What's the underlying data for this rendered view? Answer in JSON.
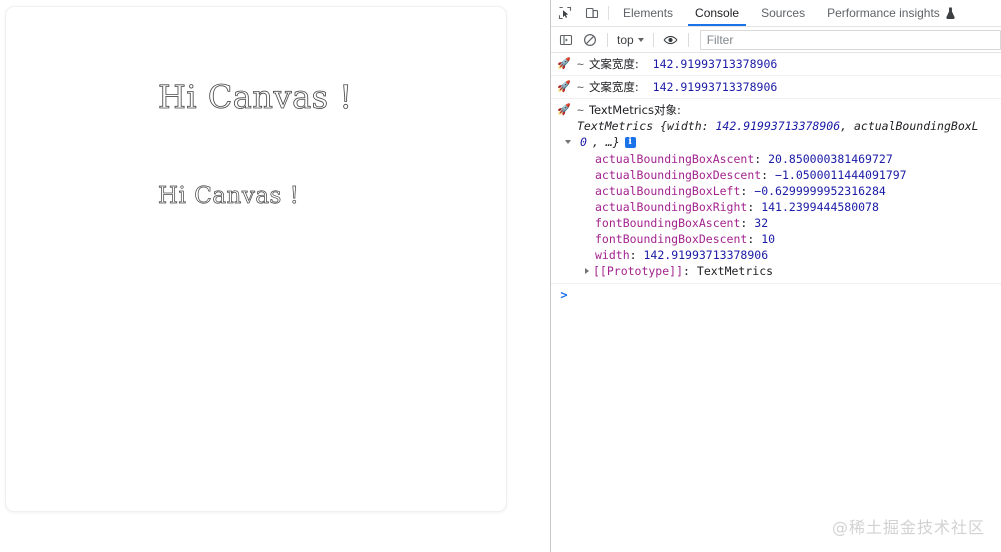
{
  "canvas": {
    "texts": [
      {
        "content": "Hi Canvas !",
        "style": "stroked-large"
      },
      {
        "content": "Hi Canvas !",
        "style": "stroked-small"
      }
    ]
  },
  "devtools": {
    "tabs": [
      {
        "label": "Elements",
        "active": false
      },
      {
        "label": "Console",
        "active": true
      },
      {
        "label": "Sources",
        "active": false
      },
      {
        "label": "Performance insights",
        "active": false,
        "icon": "flask-icon"
      }
    ],
    "icons": {
      "inspect": "inspect-element-icon",
      "device": "device-toolbar-icon",
      "sidebar": "console-sidebar-icon",
      "clear": "clear-console-icon",
      "eye": "live-expression-icon",
      "flask": "experiment-flask-icon"
    },
    "toolbar": {
      "context_label": "top",
      "filter_placeholder": "Filter",
      "filter_value": ""
    },
    "accent_color": "#1a73e8",
    "console": {
      "rows": [
        {
          "type": "log",
          "icon": "rocket",
          "tilde": "~",
          "label": "文案宽度:",
          "value": "142.91993713378906"
        },
        {
          "type": "log",
          "icon": "rocket",
          "tilde": "~",
          "label": "文案宽度:",
          "value": "142.91993713378906"
        },
        {
          "type": "object",
          "icon": "rocket",
          "tilde": "~",
          "label": "TextMetrics对象:",
          "preview_class": "TextMetrics",
          "preview_open": " {",
          "preview_key": "width: ",
          "preview_value": "142.91993713378906",
          "preview_rest": ", actualBoundingBoxL",
          "tail_value": "0",
          "tail_rest": ", …}",
          "info_badge": "i",
          "properties": [
            {
              "key": "actualBoundingBoxAscent",
              "value": "20.850000381469727"
            },
            {
              "key": "actualBoundingBoxDescent",
              "value": "−1.0500011444091797"
            },
            {
              "key": "actualBoundingBoxLeft",
              "value": "−0.6299999952316284"
            },
            {
              "key": "actualBoundingBoxRight",
              "value": "141.2399444580078"
            },
            {
              "key": "fontBoundingBoxAscent",
              "value": "32"
            },
            {
              "key": "fontBoundingBoxDescent",
              "value": "10"
            },
            {
              "key": "width",
              "value": "142.91993713378906"
            }
          ],
          "prototype_key": "[[Prototype]]",
          "prototype_value": "TextMetrics"
        }
      ],
      "prompt_symbol": ">"
    }
  },
  "watermark": {
    "text": "@稀土掘金技术社区"
  }
}
